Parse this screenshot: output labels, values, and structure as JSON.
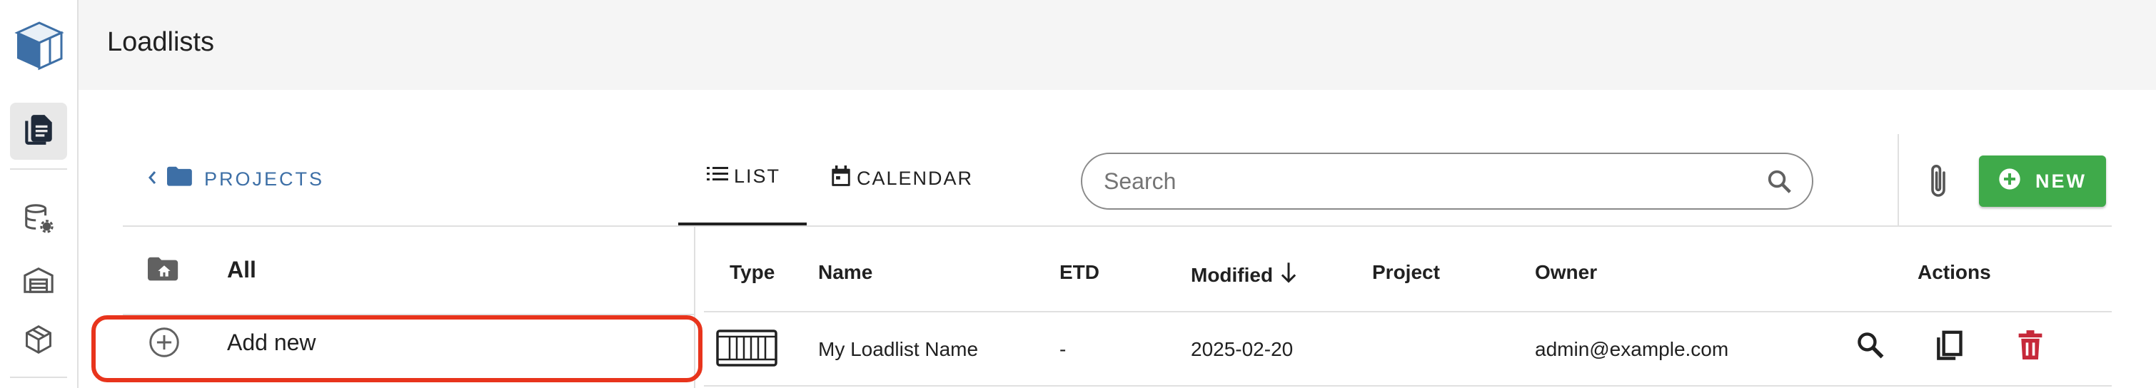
{
  "header": {
    "title": "Loadlists"
  },
  "rail": {
    "logo_icon": "app-logo-box-icon",
    "items": [
      {
        "icon": "loadlists-document-icon",
        "active": true
      },
      {
        "icon": "database-settings-icon",
        "active": false
      },
      {
        "icon": "warehouse-icon",
        "active": false
      },
      {
        "icon": "package-icon",
        "active": false
      }
    ]
  },
  "toolbar": {
    "projects_label": "PROJECTS",
    "tabs": [
      {
        "label": "LIST",
        "icon": "list-icon",
        "active": true
      },
      {
        "label": "CALENDAR",
        "icon": "calendar-icon",
        "active": false
      }
    ],
    "search": {
      "placeholder": "Search",
      "value": ""
    },
    "new_label": "NEW"
  },
  "folders": {
    "all_label": "All",
    "add_new_label": "Add new"
  },
  "table": {
    "columns": [
      "Type",
      "Name",
      "ETD",
      "Modified",
      "Project",
      "Owner",
      "Actions"
    ],
    "sort_column": "Modified",
    "sort_direction": "desc",
    "rows": [
      {
        "type_icon": "container-icon",
        "name": "My Loadlist Name",
        "etd": "-",
        "modified": "2025-02-20",
        "project": "",
        "owner": "admin@example.com",
        "actions": [
          "search-icon",
          "copy-icon",
          "delete-icon"
        ]
      }
    ]
  },
  "colors": {
    "accent_blue": "#3d6fa6",
    "new_button": "#3faa4a",
    "delete": "#c62839",
    "highlight": "#e8341c"
  }
}
